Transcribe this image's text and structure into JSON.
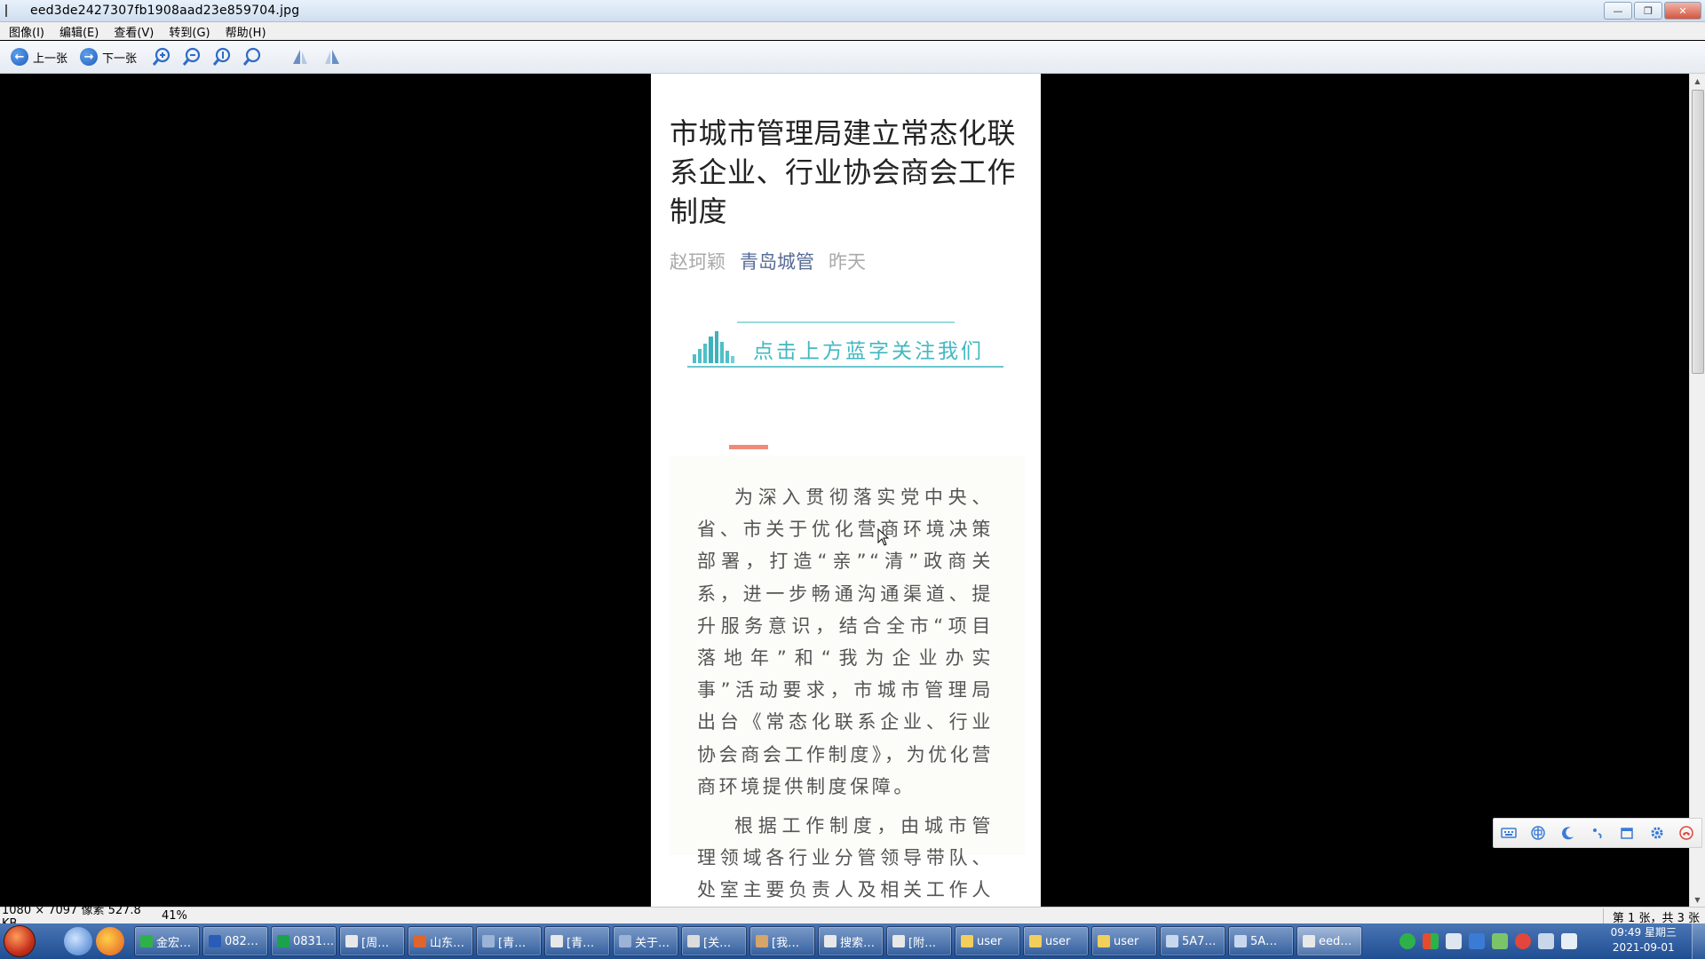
{
  "window": {
    "title": "eed3de2427307fb1908aad23e859704.jpg",
    "controls": {
      "minimize": "—",
      "maximize": "❐",
      "close": "✕"
    }
  },
  "menu": [
    "图像(I)",
    "编辑(E)",
    "查看(V)",
    "转到(G)",
    "帮助(H)"
  ],
  "toolbar": {
    "prev_label": "上一张",
    "next_label": "下一张",
    "prev_glyph": "←",
    "next_glyph": "→",
    "icons": [
      "zoom-in-icon",
      "zoom-out-icon",
      "actual-size-icon",
      "fit-icon",
      "rotate-left-icon",
      "rotate-right-icon"
    ]
  },
  "article": {
    "title": "市城市管理局建立常态化联系企业、行业协会商会工作制度",
    "author": "赵珂颖",
    "account": "青岛城管",
    "time": "昨天",
    "follow_text": "点击上方蓝字关注我们",
    "paragraph1": "为深入贯彻落实党中央、省、市关于优化营商环境决策部署，打造“亲”“清”政商关系，进一步畅通沟通渠道、提升服务意识，结合全市“项目落地年”和“我为企业办实事”活动要求，市城市管理局出台《常态化联系企业、行业协会商会工作制度》，为优化营商环境提供制度保障。",
    "paragraph2": "根据工作制度，由城市管理领域各行业分管领导带队、处室主要负责人及相关工作人员共同",
    "colors": {
      "account": "#576b95",
      "follow": "#42b8c2",
      "accent": "#f08a7c"
    }
  },
  "statusbar": {
    "info": "1080 × 7097 像素  527.8 KB",
    "zoom": "41%",
    "page": "第 1 张，共 3 张"
  },
  "taskbar": {
    "tasks": [
      {
        "label": "金宏…",
        "color": "#2fb14a"
      },
      {
        "label": "082…",
        "color": "#2b5cb8"
      },
      {
        "label": "0831…",
        "color": "#1aa34a"
      },
      {
        "label": "[周…",
        "color": "#e8e8e8"
      },
      {
        "label": "山东…",
        "color": "#e0642c"
      },
      {
        "label": "[青…",
        "color": "#9ab3d6"
      },
      {
        "label": "[青…",
        "color": "#e8e8e8"
      },
      {
        "label": "关于…",
        "color": "#9ab3d6"
      },
      {
        "label": "[关…",
        "color": "#dcdcdc"
      },
      {
        "label": "[我…",
        "color": "#d6a56a"
      },
      {
        "label": "搜索…",
        "color": "#e8e8e8"
      },
      {
        "label": "[附…",
        "color": "#e8e8e8"
      },
      {
        "label": "user",
        "color": "#f2cf5b"
      },
      {
        "label": "user",
        "color": "#f2cf5b"
      },
      {
        "label": "user",
        "color": "#f2cf5b"
      },
      {
        "label": "5A7…",
        "color": "#c7d8ee"
      },
      {
        "label": "5A…",
        "color": "#c7d8ee"
      },
      {
        "label": "eed…",
        "color": "#e8e8e8"
      }
    ],
    "clock_time": "09:49 星期三",
    "clock_date": "2021-09-01"
  },
  "ime": [
    "keyboard-icon",
    "chinese-mode-icon",
    "moon-icon",
    "punctuation-icon",
    "calendar-icon",
    "gear-icon",
    "phone-icon"
  ]
}
